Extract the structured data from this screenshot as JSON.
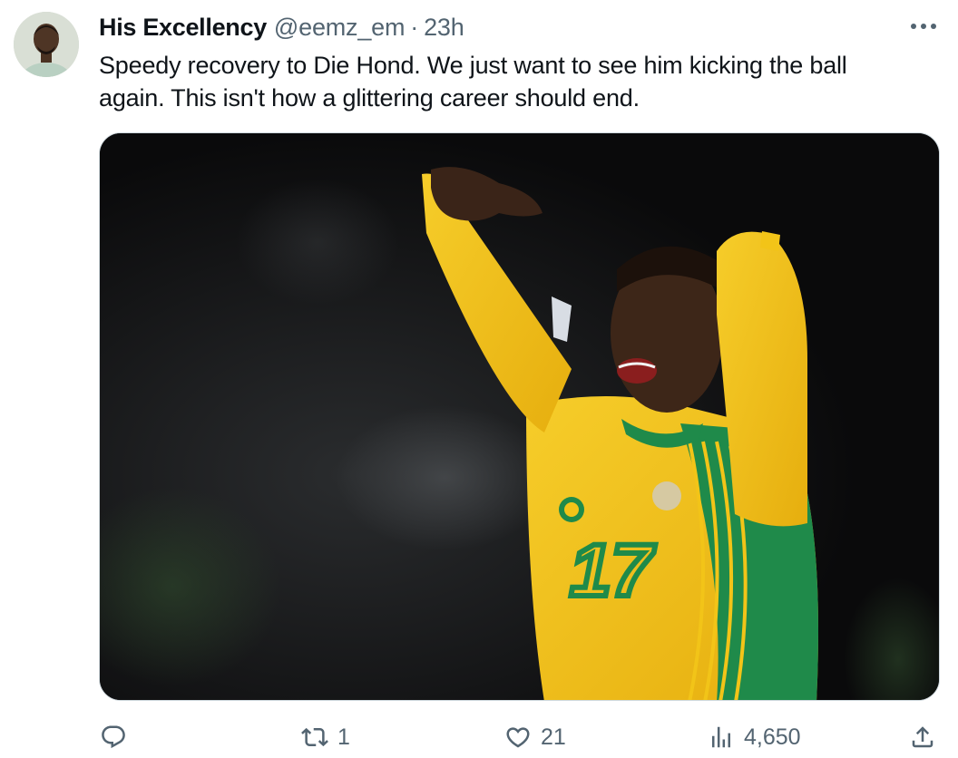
{
  "tweet": {
    "author": {
      "display_name": "His Excellency",
      "handle": "@eemz_em",
      "separator": "·",
      "time": "23h",
      "avatar_icon": "user-avatar"
    },
    "more_icon": "more-horizontal-icon",
    "text_lines": [
      "Speedy recovery to Die Hond. We just want to see him kicking the ball",
      "again. This isn't how a glittering career should end."
    ],
    "media": {
      "type": "photo",
      "jersey_number": "17"
    },
    "actions": {
      "reply": {
        "icon": "reply-icon",
        "count": ""
      },
      "retweet": {
        "icon": "retweet-icon",
        "count": "1"
      },
      "like": {
        "icon": "heart-icon",
        "count": "21"
      },
      "views": {
        "icon": "views-chart-icon",
        "count": "4,650"
      },
      "share": {
        "icon": "share-icon",
        "count": ""
      }
    }
  },
  "colors": {
    "text_primary": "#0f1419",
    "text_secondary": "#536471",
    "jersey_yellow": "#f2c418",
    "jersey_green": "#1f8a4a"
  }
}
